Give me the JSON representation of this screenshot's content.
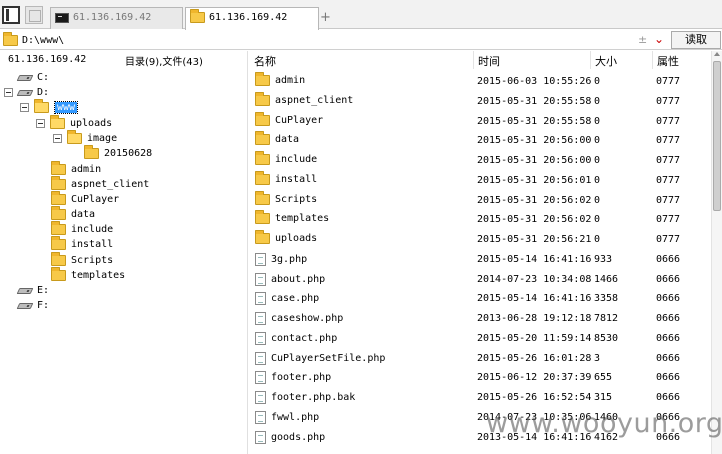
{
  "tabs": [
    {
      "label": "61.136.169.42",
      "active": false
    },
    {
      "label": "61.136.169.42",
      "active": true
    }
  ],
  "address": {
    "path": "D:\\www\\",
    "read_label": "读取"
  },
  "left": {
    "host": "61.136.169.42",
    "count": "目录(9),文件(43)",
    "drives": {
      "c": "C:",
      "d": "D:",
      "e": "E:",
      "f": "F:"
    },
    "tree": {
      "www": "www",
      "uploads": "uploads",
      "image": "image",
      "dated": "20150628",
      "admin": "admin",
      "aspnet_client": "aspnet_client",
      "cuplayer": "CuPlayer",
      "data": "data",
      "include": "include",
      "install": "install",
      "scripts": "Scripts",
      "templates": "templates"
    }
  },
  "columns": {
    "name": "名称",
    "time": "时间",
    "size": "大小",
    "perm": "属性"
  },
  "rows": [
    {
      "name": "admin",
      "time": "2015-06-03 10:55:26",
      "size": "0",
      "perm": "0777",
      "type": "dir"
    },
    {
      "name": "aspnet_client",
      "time": "2015-05-31 20:55:58",
      "size": "0",
      "perm": "0777",
      "type": "dir"
    },
    {
      "name": "CuPlayer",
      "time": "2015-05-31 20:55:58",
      "size": "0",
      "perm": "0777",
      "type": "dir"
    },
    {
      "name": "data",
      "time": "2015-05-31 20:56:00",
      "size": "0",
      "perm": "0777",
      "type": "dir"
    },
    {
      "name": "include",
      "time": "2015-05-31 20:56:00",
      "size": "0",
      "perm": "0777",
      "type": "dir"
    },
    {
      "name": "install",
      "time": "2015-05-31 20:56:01",
      "size": "0",
      "perm": "0777",
      "type": "dir"
    },
    {
      "name": "Scripts",
      "time": "2015-05-31 20:56:02",
      "size": "0",
      "perm": "0777",
      "type": "dir"
    },
    {
      "name": "templates",
      "time": "2015-05-31 20:56:02",
      "size": "0",
      "perm": "0777",
      "type": "dir"
    },
    {
      "name": "uploads",
      "time": "2015-05-31 20:56:21",
      "size": "0",
      "perm": "0777",
      "type": "dir"
    },
    {
      "name": "3g.php",
      "time": "2015-05-14 16:41:16",
      "size": "933",
      "perm": "0666",
      "type": "file"
    },
    {
      "name": "about.php",
      "time": "2014-07-23 10:34:08",
      "size": "1466",
      "perm": "0666",
      "type": "file"
    },
    {
      "name": "case.php",
      "time": "2015-05-14 16:41:16",
      "size": "3358",
      "perm": "0666",
      "type": "file"
    },
    {
      "name": "caseshow.php",
      "time": "2013-06-28 19:12:18",
      "size": "7812",
      "perm": "0666",
      "type": "file"
    },
    {
      "name": "contact.php",
      "time": "2015-05-20 11:59:14",
      "size": "8530",
      "perm": "0666",
      "type": "file"
    },
    {
      "name": "CuPlayerSetFile.php",
      "time": "2015-05-26 16:01:28",
      "size": "3",
      "perm": "0666",
      "type": "file"
    },
    {
      "name": "footer.php",
      "time": "2015-06-12 20:37:39",
      "size": "655",
      "perm": "0666",
      "type": "file"
    },
    {
      "name": "footer.php.bak",
      "time": "2015-05-26 16:52:54",
      "size": "315",
      "perm": "0666",
      "type": "file"
    },
    {
      "name": "fwwl.php",
      "time": "2014-07-23 10:35:06",
      "size": "1460",
      "perm": "0666",
      "type": "file"
    },
    {
      "name": "goods.php",
      "time": "2013-05-14 16:41:16",
      "size": "4162",
      "perm": "0666",
      "type": "file"
    }
  ],
  "watermark": "www.wooyun.org"
}
